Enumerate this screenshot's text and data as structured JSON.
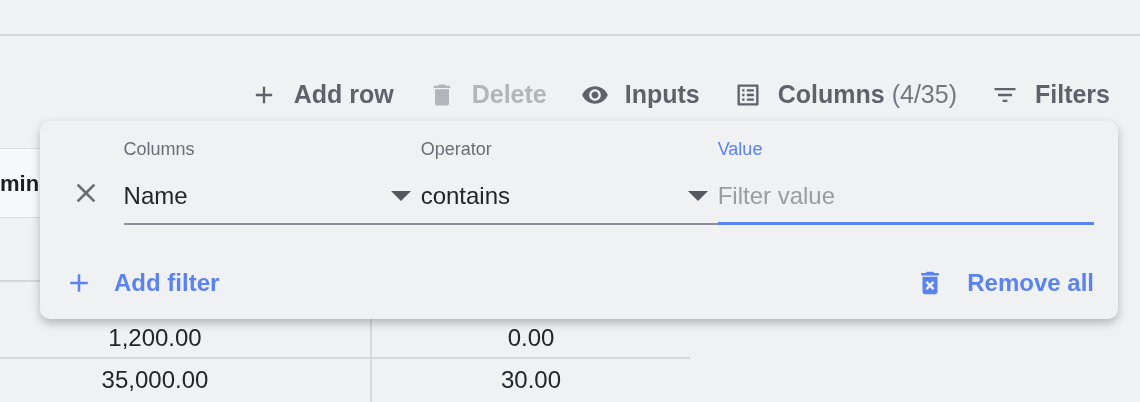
{
  "toolbar": [
    {
      "kind": "add",
      "label": "Add row",
      "disabled": false
    },
    {
      "kind": "delete",
      "label": "Delete",
      "disabled": true
    },
    {
      "kind": "inputs",
      "label": "Inputs",
      "disabled": false
    },
    {
      "kind": "columns",
      "label": "Columns",
      "count": "(4/35)",
      "disabled": false
    },
    {
      "kind": "filters",
      "label": "Filters",
      "disabled": false
    }
  ],
  "table": {
    "columns": [
      "min"
    ],
    "rows": [
      [
        "",
        ""
      ],
      [
        "1,200.00",
        "0.00"
      ],
      [
        "35,000.00",
        "30.00"
      ]
    ]
  },
  "filter_panel": {
    "filters": [
      {
        "column": {
          "label": "Columns",
          "value": "Name"
        },
        "operator": {
          "label": "Operator",
          "value": "contains"
        },
        "value": {
          "label": "Value",
          "placeholder": "Filter value",
          "focused": true
        }
      }
    ],
    "add_label": "Add filter",
    "remove_label": "Remove all"
  }
}
